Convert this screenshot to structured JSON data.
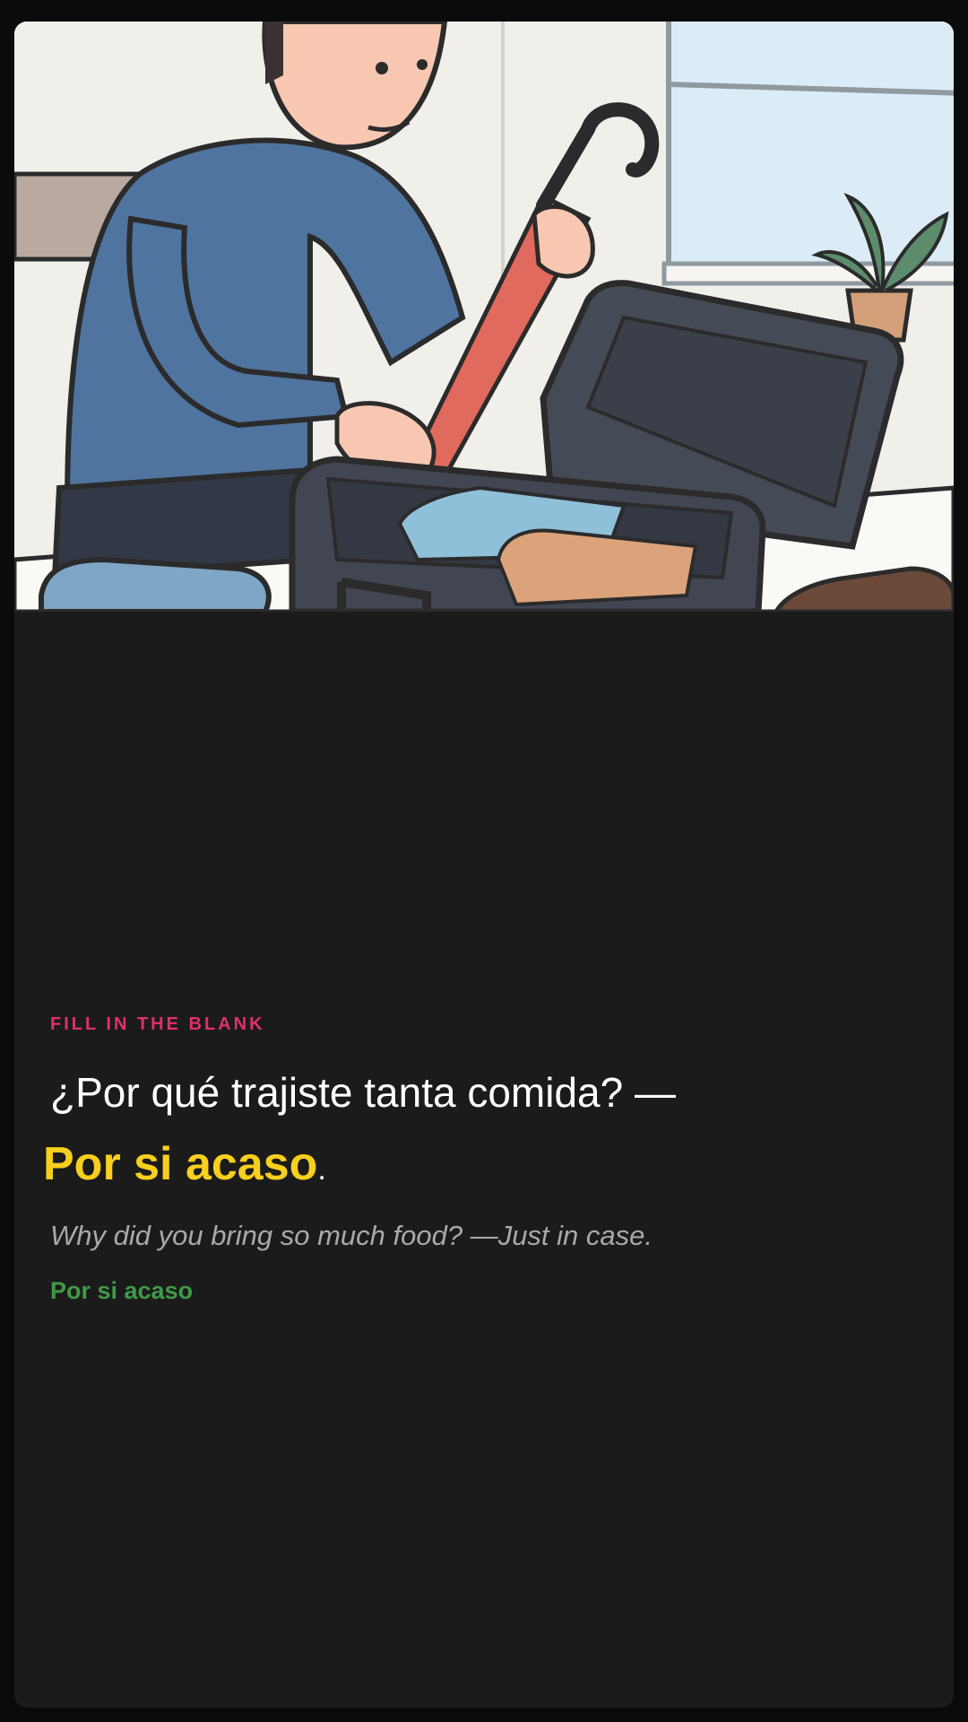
{
  "exercise": {
    "type_label": "FILL IN THE BLANK",
    "prompt_sentence": "¿Por qué trajiste tanta comida? —",
    "answer": "Por si acaso",
    "answer_punctuation": ".",
    "translation": "Why did you bring so much food? —Just in case.",
    "correct_option": "Por si acaso"
  },
  "illustration": {
    "icon": "person-packing-umbrella-in-suitcase-illustration"
  },
  "colors": {
    "background": "#1b1b1b",
    "eyebrow": "#e0306a",
    "answer": "#f7cf1d",
    "correct": "#3f9a46",
    "translation": "#a9a9a9"
  }
}
